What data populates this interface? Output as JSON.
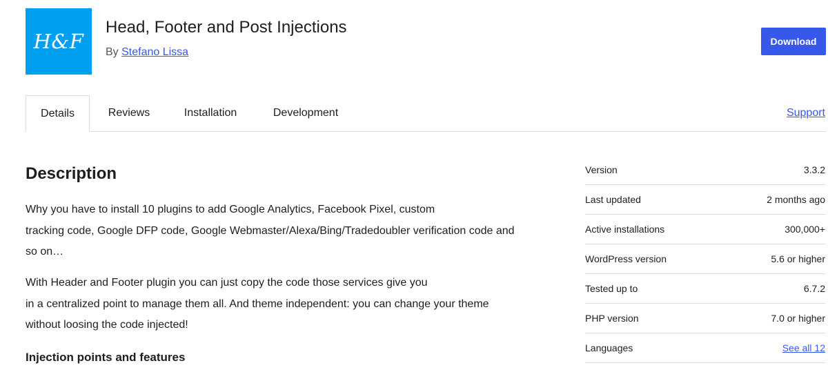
{
  "plugin": {
    "logo_text": "H&F",
    "title": "Head, Footer and Post Injections",
    "by_prefix": "By",
    "author": "Stefano Lissa",
    "download_label": "Download"
  },
  "tabs": [
    {
      "label": "Details",
      "active": true
    },
    {
      "label": "Reviews",
      "active": false
    },
    {
      "label": "Installation",
      "active": false
    },
    {
      "label": "Development",
      "active": false
    }
  ],
  "support_label": "Support",
  "description": {
    "heading": "Description",
    "paragraph1": [
      "Why you have to install 10 plugins to add Google Analytics, Facebook Pixel, custom",
      "tracking code, Google DFP code, Google Webmaster/Alexa/Bing/Tradedoubler verification code and",
      "so on…"
    ],
    "paragraph2": [
      "With Header and Footer plugin you can just copy the code those services give you",
      "in a centralized point to manage them all. And theme independent: you can change your theme",
      "without loosing the code injected!"
    ],
    "subheading": "Injection points and features"
  },
  "meta": [
    {
      "label": "Version",
      "value": "3.3.2"
    },
    {
      "label": "Last updated",
      "value": "2 months ago"
    },
    {
      "label": "Active installations",
      "value": "300,000+"
    },
    {
      "label": "WordPress version",
      "value": "5.6 or higher"
    },
    {
      "label": "Tested up to",
      "value": "6.7.2"
    },
    {
      "label": "PHP version",
      "value": "7.0 or higher"
    },
    {
      "label": "Languages",
      "value": "See all 12",
      "link": true
    }
  ],
  "colors": {
    "logo_bg": "#00a0f0",
    "accent": "#3858e9",
    "border": "#dcdcde"
  }
}
